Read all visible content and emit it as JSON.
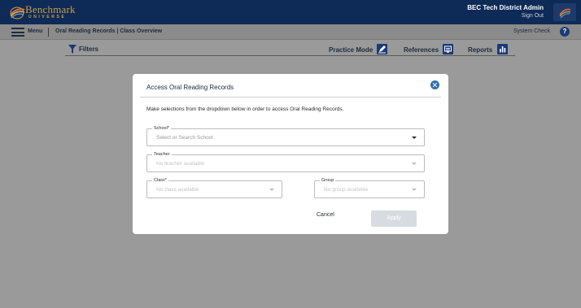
{
  "header": {
    "logo_word": "Benchmark",
    "logo_sub": "UNIVERSE",
    "user_name": "BEC Tech District Admin",
    "sign_out": "Sign Out"
  },
  "nav": {
    "menu_label": "Menu",
    "breadcrumb": "Oral Reading Records | Class Overview",
    "system_check": "System Check",
    "help": "?"
  },
  "toolbar": {
    "filters": "Filters",
    "practice_mode": "Practice Mode",
    "references": "References",
    "reports": "Reports"
  },
  "modal": {
    "title": "Access Oral Reading Records",
    "description": "Make selections from the dropdown below in order to access Oral Reading Records.",
    "school": {
      "label": "School*",
      "placeholder": "Select or Search School"
    },
    "teacher": {
      "label": "Teacher",
      "placeholder": "No teacher available"
    },
    "class": {
      "label": "Class*",
      "placeholder": "No class available"
    },
    "group": {
      "label": "Group",
      "placeholder": "No group available"
    },
    "cancel": "Cancel",
    "apply": "Apply"
  },
  "colors": {
    "header_bg": "#0e2a56",
    "accent": "#1a3a78",
    "logo_gold": "#c9a04a",
    "apply_disabled": "#d7dce2"
  }
}
